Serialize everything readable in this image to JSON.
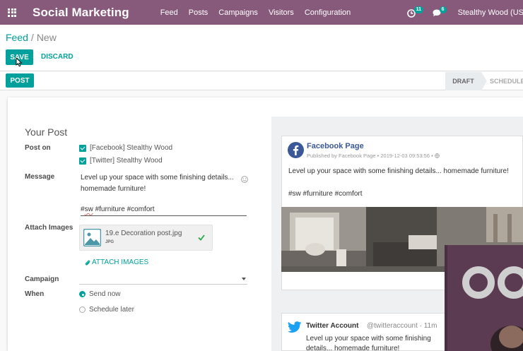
{
  "topbar": {
    "app_title": "Social Marketing",
    "menu": [
      "Feed",
      "Posts",
      "Campaigns",
      "Visitors",
      "Configuration"
    ],
    "activity_count": "11",
    "messages_count": "6",
    "user_name": "Stealthy Wood (USA)"
  },
  "breadcrumb": {
    "parent": "Feed",
    "separator": "/",
    "current": "New"
  },
  "buttons": {
    "save": "SAVE",
    "discard": "DISCARD",
    "post": "POST"
  },
  "status": {
    "draft": "DRAFT",
    "scheduled": "SCHEDULED"
  },
  "form": {
    "title": "Your Post",
    "post_on_label": "Post on",
    "accounts": [
      "[Facebook] Stealthy Wood",
      "[Twitter] Stealthy Wood"
    ],
    "message_label": "Message",
    "message_lines": [
      "Level up your space with some finishing details...",
      "homemade furniture!"
    ],
    "hashtags": {
      "misspelled": "sw",
      "rest": " #furniture #comfort",
      "hash": "#"
    },
    "attach_label": "Attach Images",
    "attachment": {
      "name": "19.e Decoration post.jpg",
      "type": "JPG"
    },
    "attach_link": "ATTACH IMAGES",
    "campaign_label": "Campaign",
    "when_label": "When",
    "when_options": [
      "Send now",
      "Schedule later"
    ],
    "when_selected": "Send now"
  },
  "preview": {
    "facebook": {
      "page_name": "Facebook Page",
      "meta": "Published by Facebook Page • 2019-12-03 09:53:56 •",
      "message": "Level up your space with some finishing details... homemade furniture!",
      "tags": "#sw #furniture #comfort"
    },
    "twitter": {
      "name": "Twitter Account",
      "handle": "@twitteraccount · 11m",
      "message": "Level up your space with some finishing details... homemade furniture!"
    }
  },
  "colors": {
    "brand": "#875a7b",
    "accent": "#00a09d",
    "facebook": "#3b5998",
    "twitter": "#1da1f2"
  }
}
